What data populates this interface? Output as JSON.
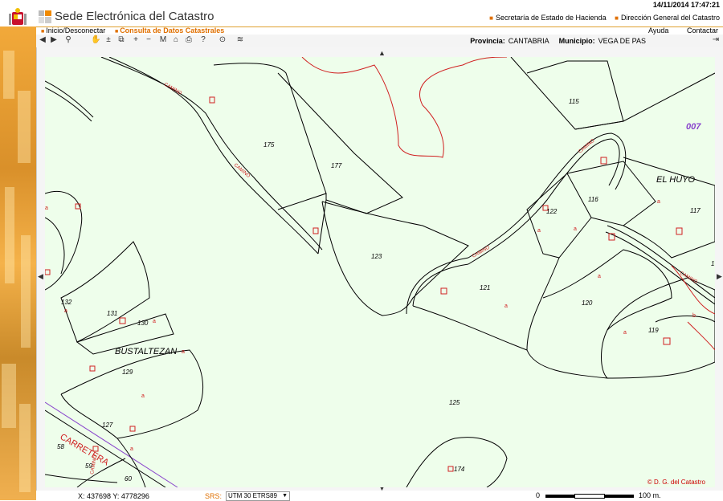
{
  "datetime": "14/11/2014 17:47:21",
  "header": {
    "title": "Sede Electrónica del Catastro",
    "links": [
      "Secretaría de Estado de Hacienda",
      "Dirección General del Catastro"
    ]
  },
  "nav": {
    "items": [
      "Inicio/Desconectar",
      "Consulta de Datos Catastrales"
    ],
    "right": [
      "Ayuda",
      "Contactar"
    ]
  },
  "location": {
    "province_label": "Provincia:",
    "province": "CANTABRIA",
    "municipality_label": "Municipio:",
    "municipality": "VEGA DE PAS"
  },
  "toolbar": {
    "icons": [
      "arrow-left-icon",
      "arrow-right-icon",
      "magnifier-icon",
      "pan-hand-icon",
      "zoom-in-icon",
      "zoom-window-icon",
      "plus-icon",
      "minus-icon",
      "measure-icon",
      "home-icon",
      "print-icon",
      "help-icon",
      "info-pin-icon",
      "layers-icon"
    ]
  },
  "map": {
    "parcels": [
      "115",
      "175",
      "177",
      "122",
      "116",
      "117",
      "123",
      "121",
      "120",
      "119",
      "132",
      "131",
      "130",
      "129",
      "127",
      "125",
      "174",
      "58",
      "59",
      "60",
      "007",
      "1"
    ],
    "places": [
      "EL HUYO",
      "BUSTALTEZAN",
      "CARRETERA"
    ],
    "road_labels": [
      "CAMINO",
      "CAMINO",
      "CAMINO",
      "CAMINO",
      "CAMINO",
      "CAMINO"
    ],
    "markers": [
      "a",
      "a",
      "a",
      "a",
      "a",
      "a",
      "a",
      "a",
      "a",
      "a",
      "a",
      "b",
      "a"
    ],
    "copyright": "© D. G. del Catastro"
  },
  "status": {
    "coords": "X: 437698 Y: 4778296",
    "srs_label": "SRS:",
    "srs_value": "UTM 30 ETRS89",
    "scale_zero": "0",
    "scale_end": "100 m."
  },
  "colors": {
    "accent": "#e07000",
    "map_bg": "#eefeeb",
    "parcel_line": "#000000",
    "label_red": "#d00000",
    "sheet_label": "#8844cc"
  }
}
